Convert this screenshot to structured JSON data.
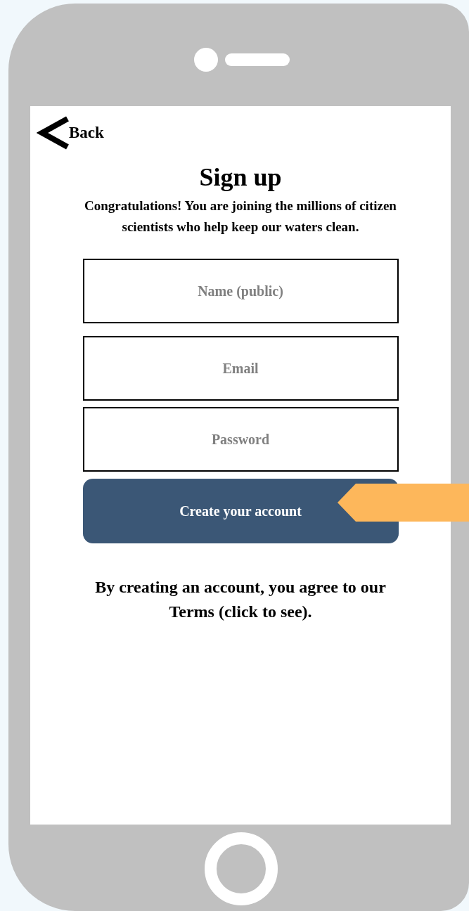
{
  "back": {
    "label": "Back"
  },
  "title": "Sign up",
  "intro": "Congratulations! You are joining the millions of citizen scientists who help keep our waters clean.",
  "fields": [
    {
      "placeholder": "Name (public)"
    },
    {
      "placeholder": "Email"
    },
    {
      "placeholder": "Password"
    }
  ],
  "submit": {
    "label": "Create your account"
  },
  "terms": "By creating an account, you agree to our Terms (click to see)."
}
